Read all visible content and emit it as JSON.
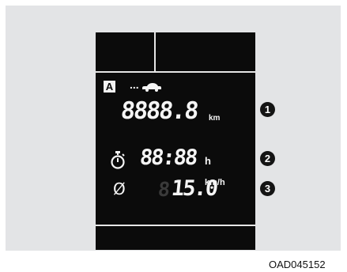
{
  "display": {
    "mode_indicator": "A",
    "trip_dots": "...",
    "odometer": {
      "value": "8888.8",
      "unit": "km"
    },
    "drive_time": {
      "value": "88:88",
      "unit": "h"
    },
    "average_speed": {
      "symbol": "Ø",
      "ghost_digit": "8",
      "value": "15.0",
      "unit": "km/h"
    },
    "icons": [
      "car-icon",
      "stopwatch-icon"
    ]
  },
  "callouts": [
    "1",
    "2",
    "3"
  ],
  "figure_code": "OAD045152",
  "colors": {
    "frame": "#e3e4e6",
    "display_bg": "#0b0b0b",
    "segment": "#f5f5f5",
    "callout": "#141414"
  }
}
